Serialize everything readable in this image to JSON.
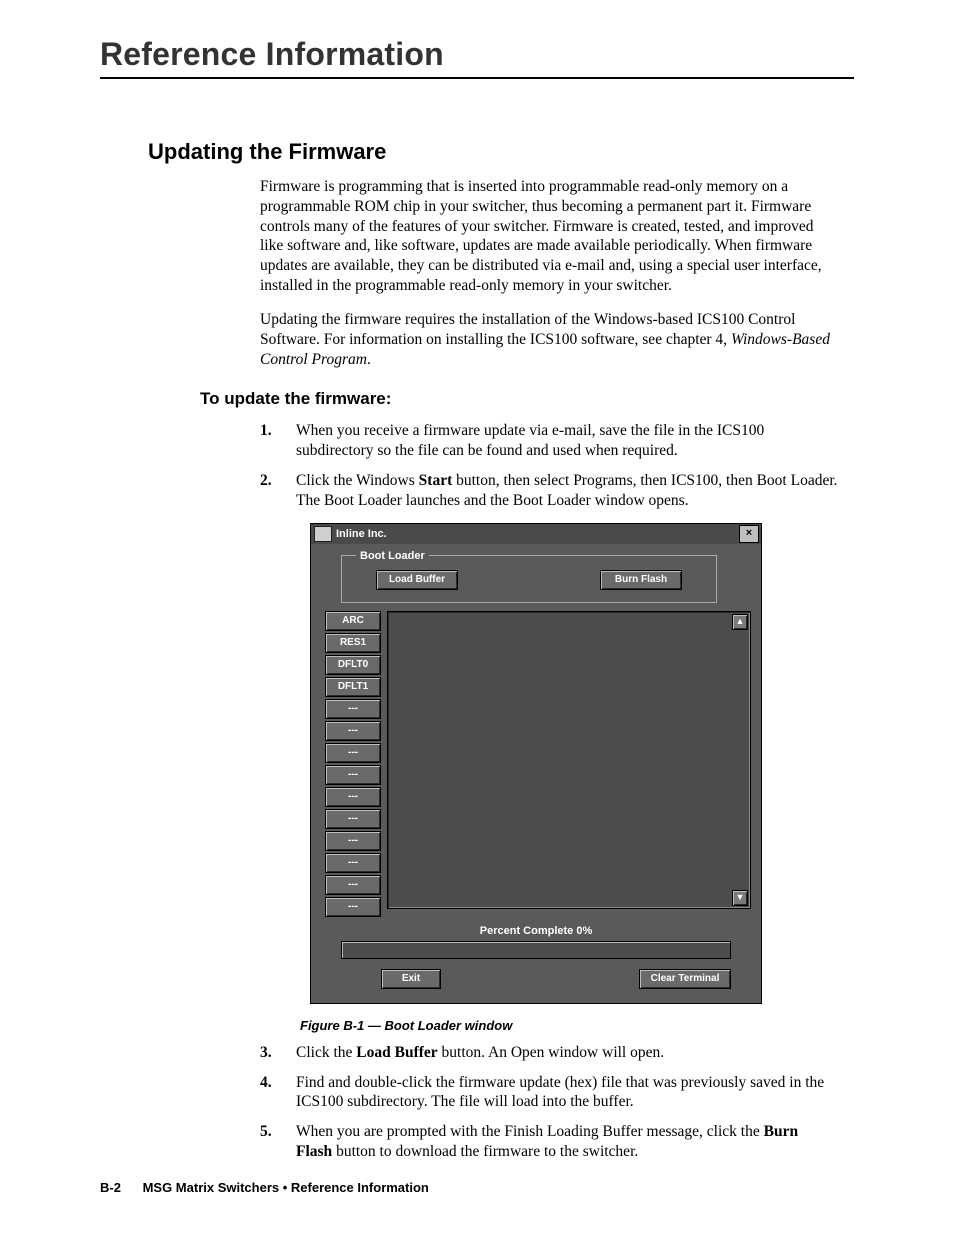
{
  "page": {
    "title": "Reference Information",
    "section_title": "Updating the Firmware",
    "sub_title": "To update the firmware:",
    "figure_caption": "Figure B-1 — Boot Loader window"
  },
  "body": {
    "p1": "Firmware is programming that is inserted into programmable read-only memory on a programmable ROM chip in your switcher, thus becoming a permanent part it. Firmware controls many of the features of your switcher.  Firmware is created, tested, and improved like software and, like software, updates are made available periodically.  When firmware updates are available, they can be distributed via e-mail and, using a special user interface, installed in the programmable read-only memory in your switcher.",
    "p2a": "Updating the firmware requires the installation of the Windows-based ICS100 Control Software.  For information on installing the ICS100 software, see chapter 4, ",
    "p2b_italic": "Windows-Based Control Program",
    "p2c": "."
  },
  "steps": [
    {
      "n": "1.",
      "t_pre": "When you receive a firmware update via e-mail, save the file in the ICS100 subdirectory so the file can be found and used when required.",
      "b": "",
      "t_post": ""
    },
    {
      "n": "2.",
      "t_pre": "Click the Windows ",
      "b": "Start",
      "t_post": " button, then select Programs, then ICS100, then Boot Loader.  The Boot Loader launches and the Boot Loader window opens."
    },
    {
      "n": "3.",
      "t_pre": "Click the ",
      "b": "Load Buffer",
      "t_post": " button.  An Open window will open."
    },
    {
      "n": "4.",
      "t_pre": "Find and double-click the firmware update (hex) file that was previously saved in the ICS100 subdirectory.  The file will load into the buffer.",
      "b": "",
      "t_post": ""
    },
    {
      "n": "5.",
      "t_pre": "When you are prompted with the Finish Loading Buffer message, click the ",
      "b": "Burn Flash",
      "t_post": " button to download the firmware to the switcher."
    }
  ],
  "app": {
    "title": "Inline Inc.",
    "legend": "Boot Loader",
    "buttons": {
      "load_buffer": "Load Buffer",
      "burn_flash": "Burn Flash",
      "exit": "Exit",
      "clear_terminal": "Clear Terminal"
    },
    "side": [
      "ARC",
      "RES1",
      "DFLT0",
      "DFLT1",
      "---",
      "---",
      "---",
      "---",
      "---",
      "---",
      "---",
      "---",
      "---",
      "---"
    ],
    "percent_label": "Percent Complete 0%"
  },
  "footer": {
    "page_no": "B-2",
    "text": "MSG Matrix Switchers • Reference Information"
  }
}
